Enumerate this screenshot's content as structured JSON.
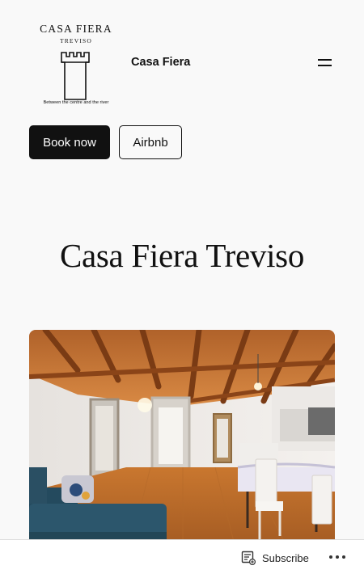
{
  "logo": {
    "title": "CASA FIERA",
    "subtitle": "TREVISO",
    "tagline": "Between the centre and the river"
  },
  "header": {
    "site_title": "Casa Fiera",
    "menu_icon": "hamburger-icon"
  },
  "actions": {
    "book_label": "Book now",
    "airbnb_label": "Airbnb"
  },
  "main": {
    "page_title": "Casa Fiera Treviso",
    "hero_image": "living-room-photo"
  },
  "footer_bar": {
    "subscribe_label": "Subscribe",
    "subscribe_icon": "reader-subscribe-icon",
    "more_icon": "ellipsis-icon"
  },
  "colors": {
    "background": "#f9f9f9",
    "primary_button": "#111111",
    "text": "#111111"
  }
}
